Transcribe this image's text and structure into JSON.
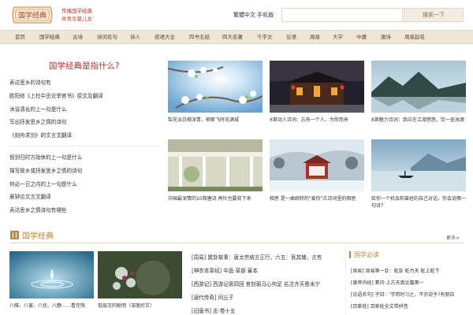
{
  "header": {
    "logo_text": "国学经典",
    "slogan_line1": "传播国学经典",
    "slogan_line2": "弄育华夏儿女",
    "lang_traditional": "繁體中文",
    "lang_mobile": "手机版",
    "search_placeholder": "",
    "search_button": "搜索一下"
  },
  "nav": {
    "items": [
      "首页",
      "国学经典",
      "古诗",
      "诗词名句",
      "诗人",
      "成语大全",
      "四书五经",
      "四大名著",
      "千字文",
      "论语",
      "周易",
      "大学",
      "中庸",
      "唐诗",
      "周易起名"
    ]
  },
  "intro": {
    "title": "国学经典是指什么?",
    "links_top": [
      "表达思乡的诗句有",
      "欧阳修《上杜中丞论举官书》原文及翻译",
      "沐浴清化的上一句是什么",
      "写出抒发思乡之情的诗句",
      "《刻舟求剑》的文言文翻译"
    ],
    "links_bottom": [
      "恨到归时方始休的上一句是什么",
      "描写故乡或抒发思乡之情的诗句",
      "何必一日之内的上一句是什么",
      "晨钟论文言文翻译",
      "表达思乡之情诗句有哪些"
    ]
  },
  "cards": [
    {
      "caption": "梨花淡白柳深青，柳絮飞时花满城"
    },
    {
      "caption": "6首动人诗词：忘有一个人，为你而来"
    },
    {
      "caption": "8首魅力诗词：我应在江湖悠悠，饮一壶浊酒"
    },
    {
      "caption": "中国最深情的10首唐诗 再忙也要背下来"
    },
    {
      "caption": "相思 是一曲婉转的\"爱你\"古诗词里的相思"
    },
    {
      "caption": "给你一个机会和曾经的自己对话，你会说哪一句诗？"
    }
  ],
  "section": {
    "title": "国学经典",
    "more": "更多>"
  },
  "bottom_cards": [
    {
      "caption": "八维、八害、八优、八静……看完恍"
    },
    {
      "caption": "低层次的聪明（深度好文）"
    }
  ],
  "classics_list": [
    "[周易] 巽卦故事：唐太宗纳言正行，六五：艮其辅，言有",
    "[神农本草经] 中品·草部·蓋本",
    "[西游记] 西游记第四回 官封弼马心何足 名注齐天意未宁",
    "[唐代传奇] 间丘子",
    "[旧唐书] 志·卷十五"
  ],
  "must_read": {
    "title": "国学必读",
    "items": [
      "[周易] 周易第一卦：乾卦 乾为天 乾上乾下",
      "[黄帝内经] 素问·上古天真论篇第一",
      "[论语名句] 子曰：'学而时习之，不亦说乎?有朋自",
      "[百家姓] 百家姓全文带拼音"
    ]
  },
  "colors": {
    "accent_red": "#b5322a",
    "accent_gold": "#b8863d",
    "nav_bg": "#efe6d6"
  }
}
